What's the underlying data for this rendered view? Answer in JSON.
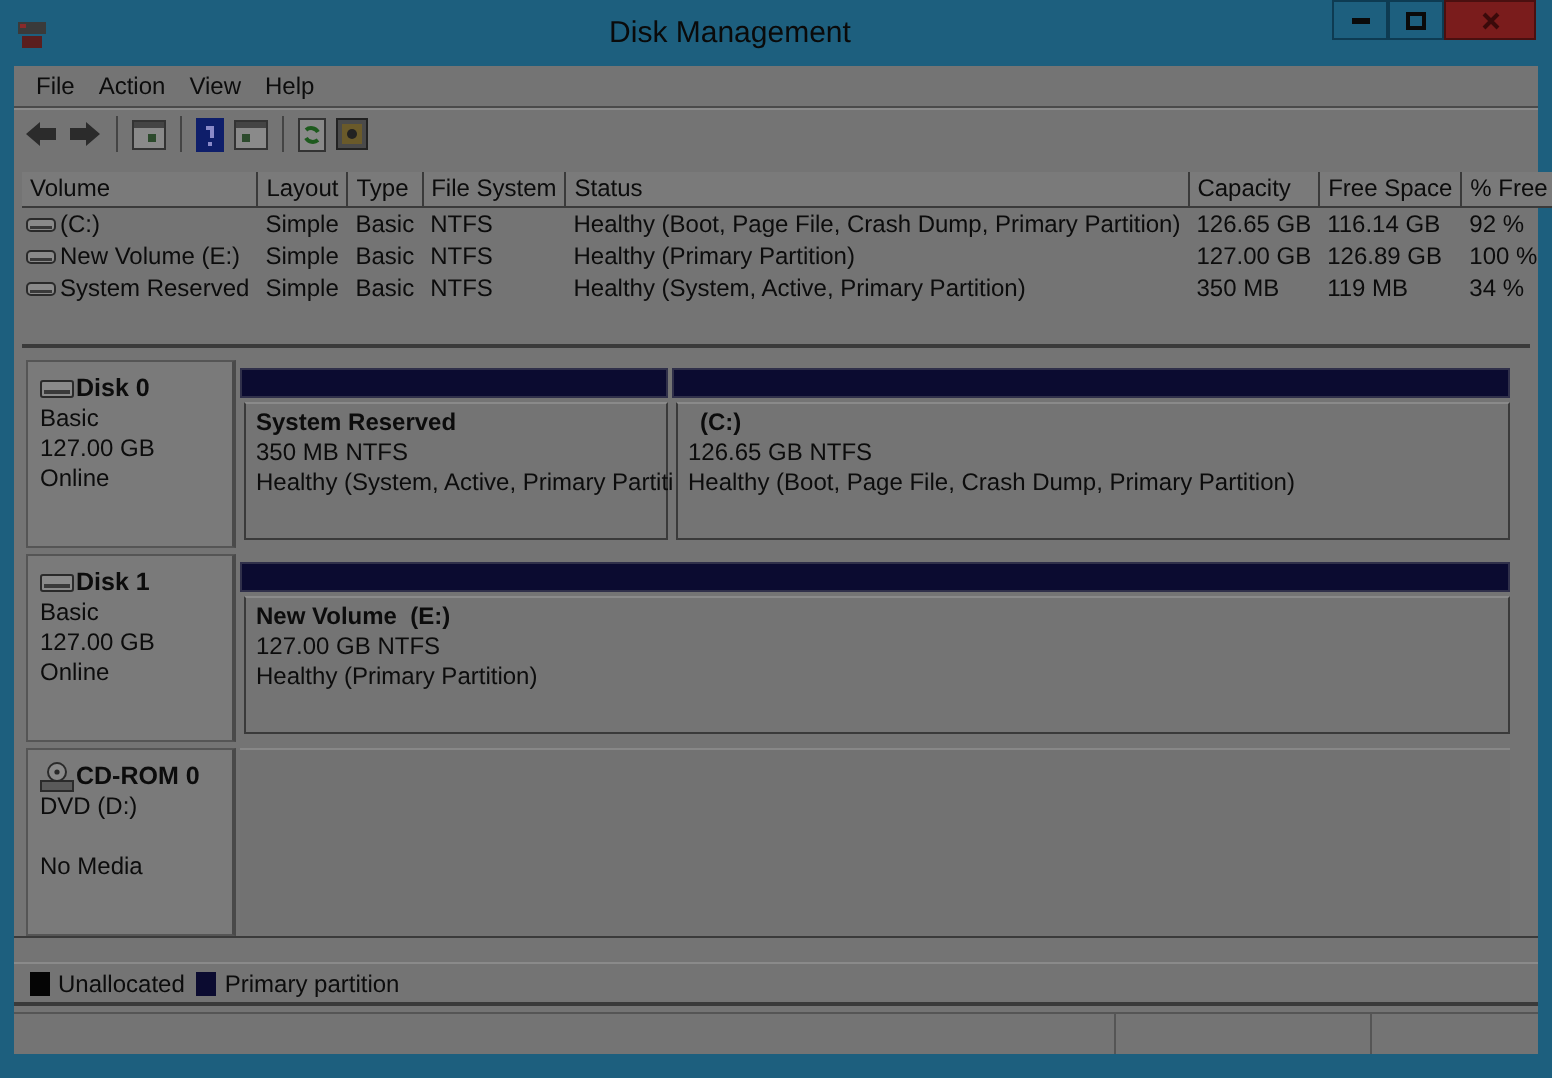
{
  "window": {
    "title": "Disk Management"
  },
  "menu": [
    {
      "label": "File"
    },
    {
      "label": "Action"
    },
    {
      "label": "View"
    },
    {
      "label": "Help"
    }
  ],
  "volumes": {
    "columns": [
      "Volume",
      "Layout",
      "Type",
      "File System",
      "Status",
      "Capacity",
      "Free Space",
      "% Free"
    ],
    "rows": [
      {
        "cells": [
          "(C:)",
          "Simple",
          "Basic",
          "NTFS",
          "Healthy (Boot, Page File, Crash Dump, Primary Partition)",
          "126.65 GB",
          "116.14 GB",
          "92 %"
        ]
      },
      {
        "cells": [
          "New Volume (E:)",
          "Simple",
          "Basic",
          "NTFS",
          "Healthy (Primary Partition)",
          "127.00 GB",
          "126.89 GB",
          "100 %"
        ]
      },
      {
        "cells": [
          "System Reserved",
          "Simple",
          "Basic",
          "NTFS",
          "Healthy (System, Active, Primary Partition)",
          "350 MB",
          "119 MB",
          "34 %"
        ]
      }
    ]
  },
  "disks": [
    {
      "kind": "disk",
      "name": "Disk 0",
      "lines": [
        "Basic",
        "127.00 GB",
        "Online"
      ],
      "partitions": [
        {
          "title": "System Reserved",
          "size": "350 MB NTFS",
          "status": "Healthy (System, Active, Primary Partiti",
          "color": "#0b0b30"
        },
        {
          "title": "(C:)",
          "size": "126.65 GB NTFS",
          "status": "Healthy (Boot, Page File, Crash Dump, Primary Partition)",
          "color": "#0b0b30"
        }
      ]
    },
    {
      "kind": "disk",
      "name": "Disk 1",
      "lines": [
        "Basic",
        "127.00 GB",
        "Online"
      ],
      "partitions": [
        {
          "title": "New Volume  (E:)",
          "size": "127.00 GB NTFS",
          "status": "Healthy (Primary Partition)",
          "color": "#0b0b30"
        }
      ]
    },
    {
      "kind": "cdrom",
      "name": "CD-ROM 0",
      "lines": [
        "DVD (D:)",
        "No Media"
      ]
    }
  ],
  "legend": [
    {
      "label": "Unallocated",
      "color": "#050505"
    },
    {
      "label": "Primary partition",
      "color": "#0b0b30"
    }
  ]
}
